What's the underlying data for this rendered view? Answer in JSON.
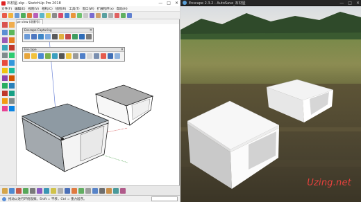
{
  "sketchup": {
    "title": "石材屋.skp - SketchUp Pro 2018",
    "menu": [
      "文件(F)",
      "编辑(E)",
      "视图(V)",
      "相机(C)",
      "绘图(R)",
      "工具(T)",
      "窗口(W)",
      "扩展程序(x)",
      "帮助(H)"
    ],
    "scene_tab": "Enscape view (场景号)",
    "toolbar_capturing": "Enscape Capturing",
    "toolbar_enscape": "Enscape",
    "status_text": "拖动以进行环绕观察。Shift = 平移，Ctrl = 重力居序。",
    "accent": "#2f6db8"
  },
  "enscape": {
    "title": "Enscape 2.3.2 - AutoSave_石材屋",
    "watermark": "Uzing.net"
  }
}
